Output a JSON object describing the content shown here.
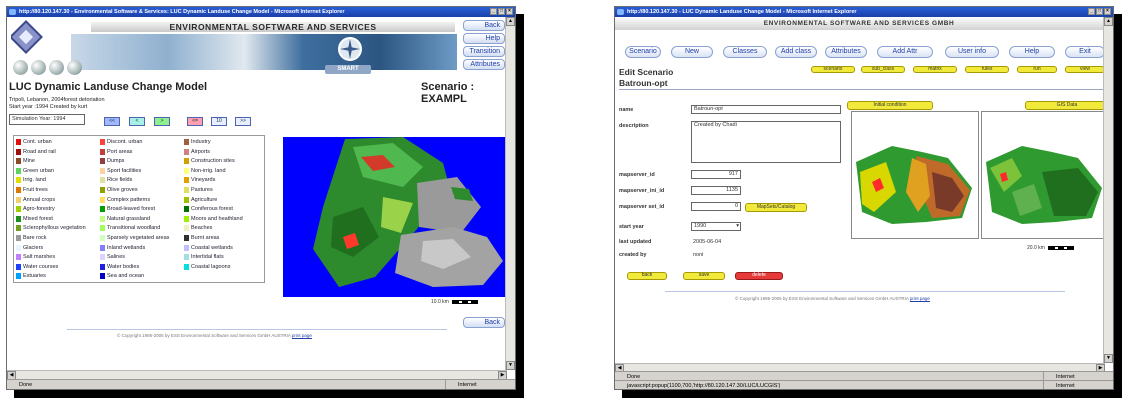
{
  "left_window": {
    "title": "http://80.120.147.30 - Environmental Software & Services: LUC Dynamic Landuse Change Model - Microsoft Internet Explorer",
    "banner_title": "ENVIRONMENTAL SOFTWARE AND SERVICES",
    "smart_label": "SMART",
    "nav_buttons": [
      "Back",
      "Help",
      "Transition",
      "Attributes"
    ],
    "page_title": "LUC Dynamic Landuse Change Model",
    "scenario_label": "Scenario : EXAMPL",
    "subtitle": "Tripoli, Lebanon, 2004forest detoriation",
    "start_line": "Start year :1994 Created by kurt",
    "year_value": "Simulation Year: 1994",
    "step_buttons": [
      "<<",
      "<",
      ">",
      "<=",
      "10",
      ">>"
    ],
    "legend": [
      {
        "label": "Cont. urban",
        "color": "#e01010"
      },
      {
        "label": "Road and rail",
        "color": "#a01010"
      },
      {
        "label": "Mine",
        "color": "#8b4b2b"
      },
      {
        "label": "Green urban",
        "color": "#5fd35f"
      },
      {
        "label": "Irrig. land",
        "color": "#e0e000"
      },
      {
        "label": "Fruit trees",
        "color": "#e07800"
      },
      {
        "label": "Annual crops",
        "color": "#f0d070"
      },
      {
        "label": "Agro-forestry",
        "color": "#a0d000"
      },
      {
        "label": "Mixed forest",
        "color": "#1f8f1f"
      },
      {
        "label": "Sclerophyllous vegetation",
        "color": "#6f9f1f"
      },
      {
        "label": "Bare rock",
        "color": "#9a9a9a"
      },
      {
        "label": "Glaciers",
        "color": "#e8f4ff"
      },
      {
        "label": "Salt marshes",
        "color": "#c080ff"
      },
      {
        "label": "Water courses",
        "color": "#2040ff"
      },
      {
        "label": "Estuaries",
        "color": "#00a0ff"
      },
      {
        "label": "Discont. urban",
        "color": "#ff4040"
      },
      {
        "label": "Port areas",
        "color": "#c04040"
      },
      {
        "label": "Dumps",
        "color": "#904040"
      },
      {
        "label": "Sport facilities",
        "color": "#ffd0a0"
      },
      {
        "label": "Rice fields",
        "color": "#e0e0a0"
      },
      {
        "label": "Olive groves",
        "color": "#90a000"
      },
      {
        "label": "Complex patterns",
        "color": "#ffe060"
      },
      {
        "label": "Broad-leaved forest",
        "color": "#00a000"
      },
      {
        "label": "Natural grassland",
        "color": "#c0ff80"
      },
      {
        "label": "Transitional woodland",
        "color": "#a0ff60"
      },
      {
        "label": "Sparsely vegetated areas",
        "color": "#d0ffc0"
      },
      {
        "label": "Inland wetlands",
        "color": "#8080ff"
      },
      {
        "label": "Salines",
        "color": "#e0d0ff"
      },
      {
        "label": "Water bodies",
        "color": "#2020e0"
      },
      {
        "label": "Sea and ocean",
        "color": "#0000c0"
      },
      {
        "label": "Industry",
        "color": "#a06040"
      },
      {
        "label": "Airports",
        "color": "#d08080"
      },
      {
        "label": "Construction sites",
        "color": "#d0a000"
      },
      {
        "label": "Non-irrig. land",
        "color": "#ffff80"
      },
      {
        "label": "Vineyards",
        "color": "#e0a000"
      },
      {
        "label": "Pastures",
        "color": "#e0e060"
      },
      {
        "label": "Agriculture",
        "color": "#a0c000"
      },
      {
        "label": "Coniferous forest",
        "color": "#007000"
      },
      {
        "label": "Moors and heathland",
        "color": "#a0f000"
      },
      {
        "label": "Beaches",
        "color": "#f0f0c0"
      },
      {
        "label": "Burnt areas",
        "color": "#303030"
      },
      {
        "label": "Coastal wetlands",
        "color": "#c0c0ff"
      },
      {
        "label": "Intertidal flats",
        "color": "#a0e0e0"
      },
      {
        "label": "Coastal lagoons",
        "color": "#00e0e0"
      }
    ],
    "scale_label": "10.0 km",
    "back_bottom": "Back",
    "copyright": "© Copyright 1995-2005 by   ESS  Environmental Software and Services GmbH AUSTRIA",
    "print_link": "print page",
    "status": "Done",
    "zone": "Internet"
  },
  "right_window": {
    "title": "http://80.120.147.30 - LUC Dynamic Landuse Change Model - Microsoft Internet Explorer",
    "banner_title": "ENVIRONMENTAL SOFTWARE AND SERVICES GMBH",
    "toolbar": [
      "Scenario",
      "New",
      "Classes",
      "Add class",
      "Attributes",
      "Add Attr",
      "User info",
      "Help",
      "Exit"
    ],
    "edit_title": "Edit Scenario",
    "scenario_name": "Batroun-opt",
    "tabs": [
      "scenario",
      "sub_class",
      "matrix",
      "rules",
      "run",
      "view"
    ],
    "form": {
      "name_label": "name",
      "name_value": "Batroun-opt",
      "description_label": "description",
      "description_value": "Created by Chadi",
      "mapserver_id_label": "mapserver_id",
      "mapserver_id_value": "917",
      "mapserver_ini_id_label": "mapserver_ini_id",
      "mapserver_ini_id_value": "1135",
      "mapserver_set_id_label": "mapserver set_id",
      "mapserver_set_id_value": "0",
      "catalog_button": "MapSets/Catalog",
      "start_year_label": "start year",
      "start_year_value": "1990",
      "last_updated_label": "last updated",
      "last_updated_value": "2005-06-04",
      "created_by_label": "created by",
      "created_by_value": "noni"
    },
    "panel_buttons": [
      "Initial condition",
      "GIS Data"
    ],
    "actions": [
      "back",
      "save",
      "delete"
    ],
    "scale_label": "20.0 km",
    "copyright": "© Copyright 1995-2005 by   ESS  Environmental Software and Services GmbH AUSTRIA",
    "print_link": "print page",
    "status": "Done",
    "zone": "Internet",
    "status2": "javascript:popup(1100,700,'http://80.120.147.30/LUC/LUCGIS')",
    "zone2": "Internet"
  },
  "colors": {
    "titlebar": "#1a3fa8",
    "link_blue": "#2040a8",
    "yellow_button": "#f2ea3a",
    "delete_red": "#e63a3a",
    "sea_blue": "#0000fe"
  }
}
